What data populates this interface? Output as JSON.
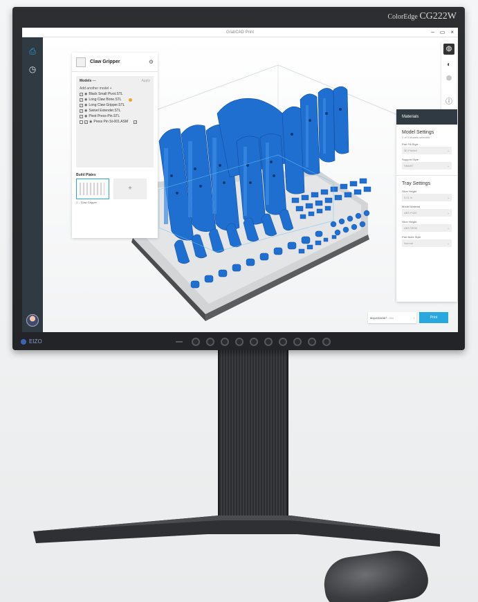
{
  "monitor": {
    "brand_small": "ColorEdge",
    "brand_model": "CG222W",
    "maker": "EIZO"
  },
  "app": {
    "window_title": "GrabCAD Print",
    "controls": [
      "–",
      "▭",
      "×"
    ]
  },
  "rail": {
    "icons": [
      "printer-icon",
      "history-icon"
    ]
  },
  "project": {
    "name": "Claw Gripper",
    "models_header": "Models",
    "models_badge": "—",
    "apply": "Apply",
    "add_model": "Add another model",
    "add_symbol": "+",
    "models": [
      {
        "name": "Black Small Pivot.STL",
        "flag": false
      },
      {
        "name": "Long Claw Bone.STL",
        "flag": true
      },
      {
        "name": "Long Claw Gripper.STL",
        "flag": false
      },
      {
        "name": "Swivel Extender.STL",
        "flag": false
      },
      {
        "name": "Pivot Press-Pin.STL",
        "flag": false
      },
      {
        "name": "Press Pin St-001.ASM",
        "flag": false
      }
    ],
    "build_plates_label": "Build Plates",
    "plate_caption": "1 – Claw Gripper",
    "add_plate": "+"
  },
  "materials": {
    "header": "Materials",
    "model_settings": "Model Settings",
    "model_settings_sub": "2 of 3 Models selected",
    "part_fill_label": "Part Fill Style",
    "part_fill_value": "3D Printed",
    "support_label": "Support Style",
    "support_value": "SMART",
    "tray_settings": "Tray Settings",
    "slice_label": "Slice Height",
    "slice_value": "0.01 in",
    "model_material_label": "Model Material",
    "model_material_value": "ABS P430",
    "slice2_label": "Slice Height",
    "slice2_value": "ABS SR30",
    "build_style_label": "Part Build Style",
    "build_style_value": "Normal"
  },
  "bottom": {
    "printer": "Mojo0334567",
    "printer_status": "Idle",
    "arrow": "›",
    "print": "Print"
  },
  "colors": {
    "accent": "#29a8e0",
    "model_blue": "#1f6fd1",
    "rail": "#2f3a43",
    "flag": "#f4a11d"
  }
}
